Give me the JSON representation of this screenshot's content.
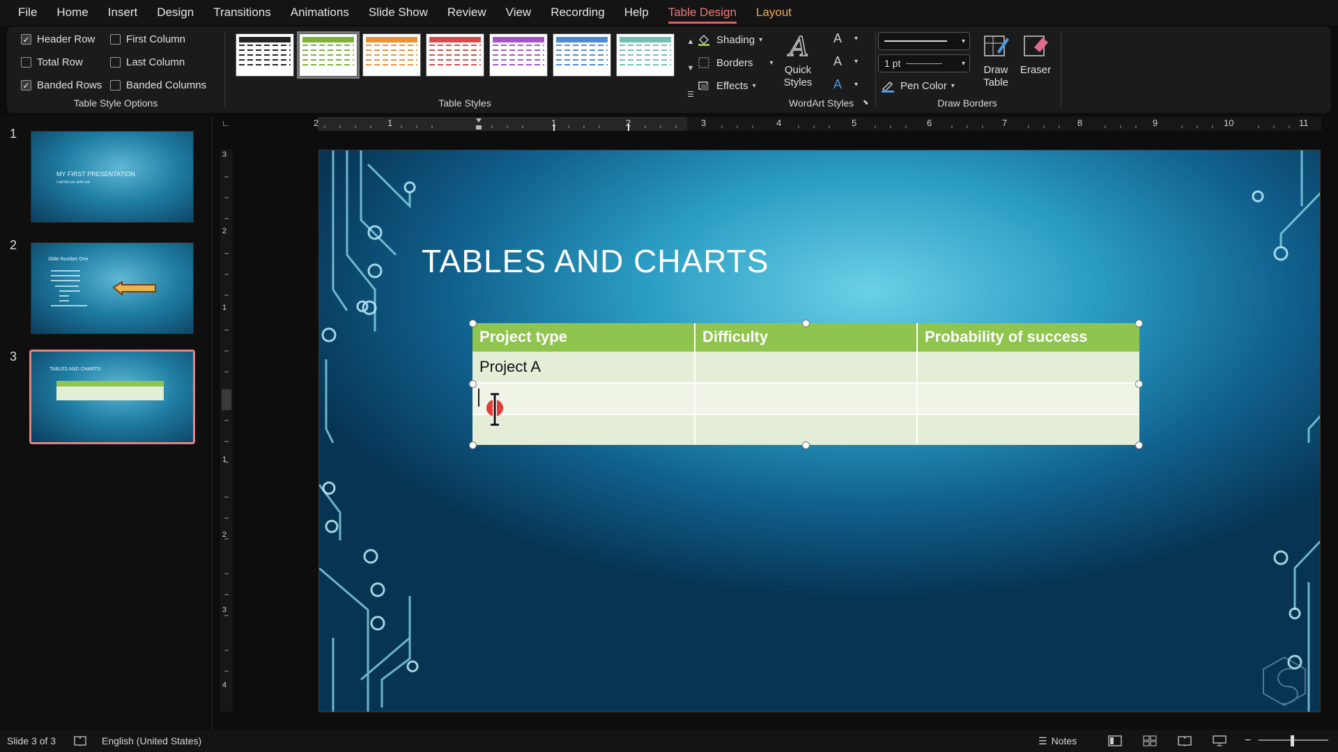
{
  "menu": {
    "tabs": [
      "File",
      "Home",
      "Insert",
      "Design",
      "Transitions",
      "Animations",
      "Slide Show",
      "Review",
      "View",
      "Recording",
      "Help",
      "Table Design",
      "Layout"
    ]
  },
  "ribbon": {
    "style_options": {
      "label": "Table Style Options",
      "header_row": "Header Row",
      "first_column": "First Column",
      "total_row": "Total Row",
      "last_column": "Last Column",
      "banded_rows": "Banded Rows",
      "banded_columns": "Banded Columns",
      "header_row_checked": true,
      "first_column_checked": false,
      "total_row_checked": false,
      "last_column_checked": false,
      "banded_rows_checked": true,
      "banded_columns_checked": false
    },
    "table_styles": {
      "label": "Table Styles",
      "colors": [
        "#222222",
        "#7fb13a",
        "#e8923a",
        "#d44c4c",
        "#a454c7",
        "#4a8bd4",
        "#6fc0b2"
      ],
      "selected_index": 1
    },
    "shading": "Shading",
    "borders": "Borders",
    "effects": "Effects",
    "wordart": {
      "quick_styles_line1": "Quick",
      "quick_styles_line2": "Styles",
      "label": "WordArt Styles"
    },
    "draw_borders": {
      "pen_weight": "1 pt",
      "pen_color": "Pen Color",
      "draw_table_line1": "Draw",
      "draw_table_line2": "Table",
      "eraser": "Eraser",
      "label": "Draw Borders"
    }
  },
  "thumbnails": [
    {
      "number": "1",
      "title": "MY FIRST PRESENTATION",
      "subtitle": "I will tell you stuff now"
    },
    {
      "number": "2",
      "title": "Slide Number One"
    },
    {
      "number": "3",
      "title": "TABLES AND CHARTS"
    }
  ],
  "rulers": {
    "horizontal": [
      "2",
      "1",
      "1",
      "2",
      "3",
      "4",
      "5",
      "6",
      "7",
      "8",
      "9",
      "10",
      "11"
    ],
    "vertical": [
      "3",
      "2",
      "1",
      "1",
      "2",
      "3",
      "4"
    ]
  },
  "slide": {
    "title": "TABLES AND CHARTS",
    "table": {
      "headers": [
        "Project type",
        "Difficulty",
        "Probability of success"
      ],
      "rows": [
        [
          "Project A",
          "",
          ""
        ],
        [
          "",
          "",
          ""
        ],
        [
          "",
          "",
          ""
        ]
      ]
    }
  },
  "statusbar": {
    "slide_counter": "Slide 3 of 3",
    "language": "English (United States)",
    "notes": "Notes"
  }
}
